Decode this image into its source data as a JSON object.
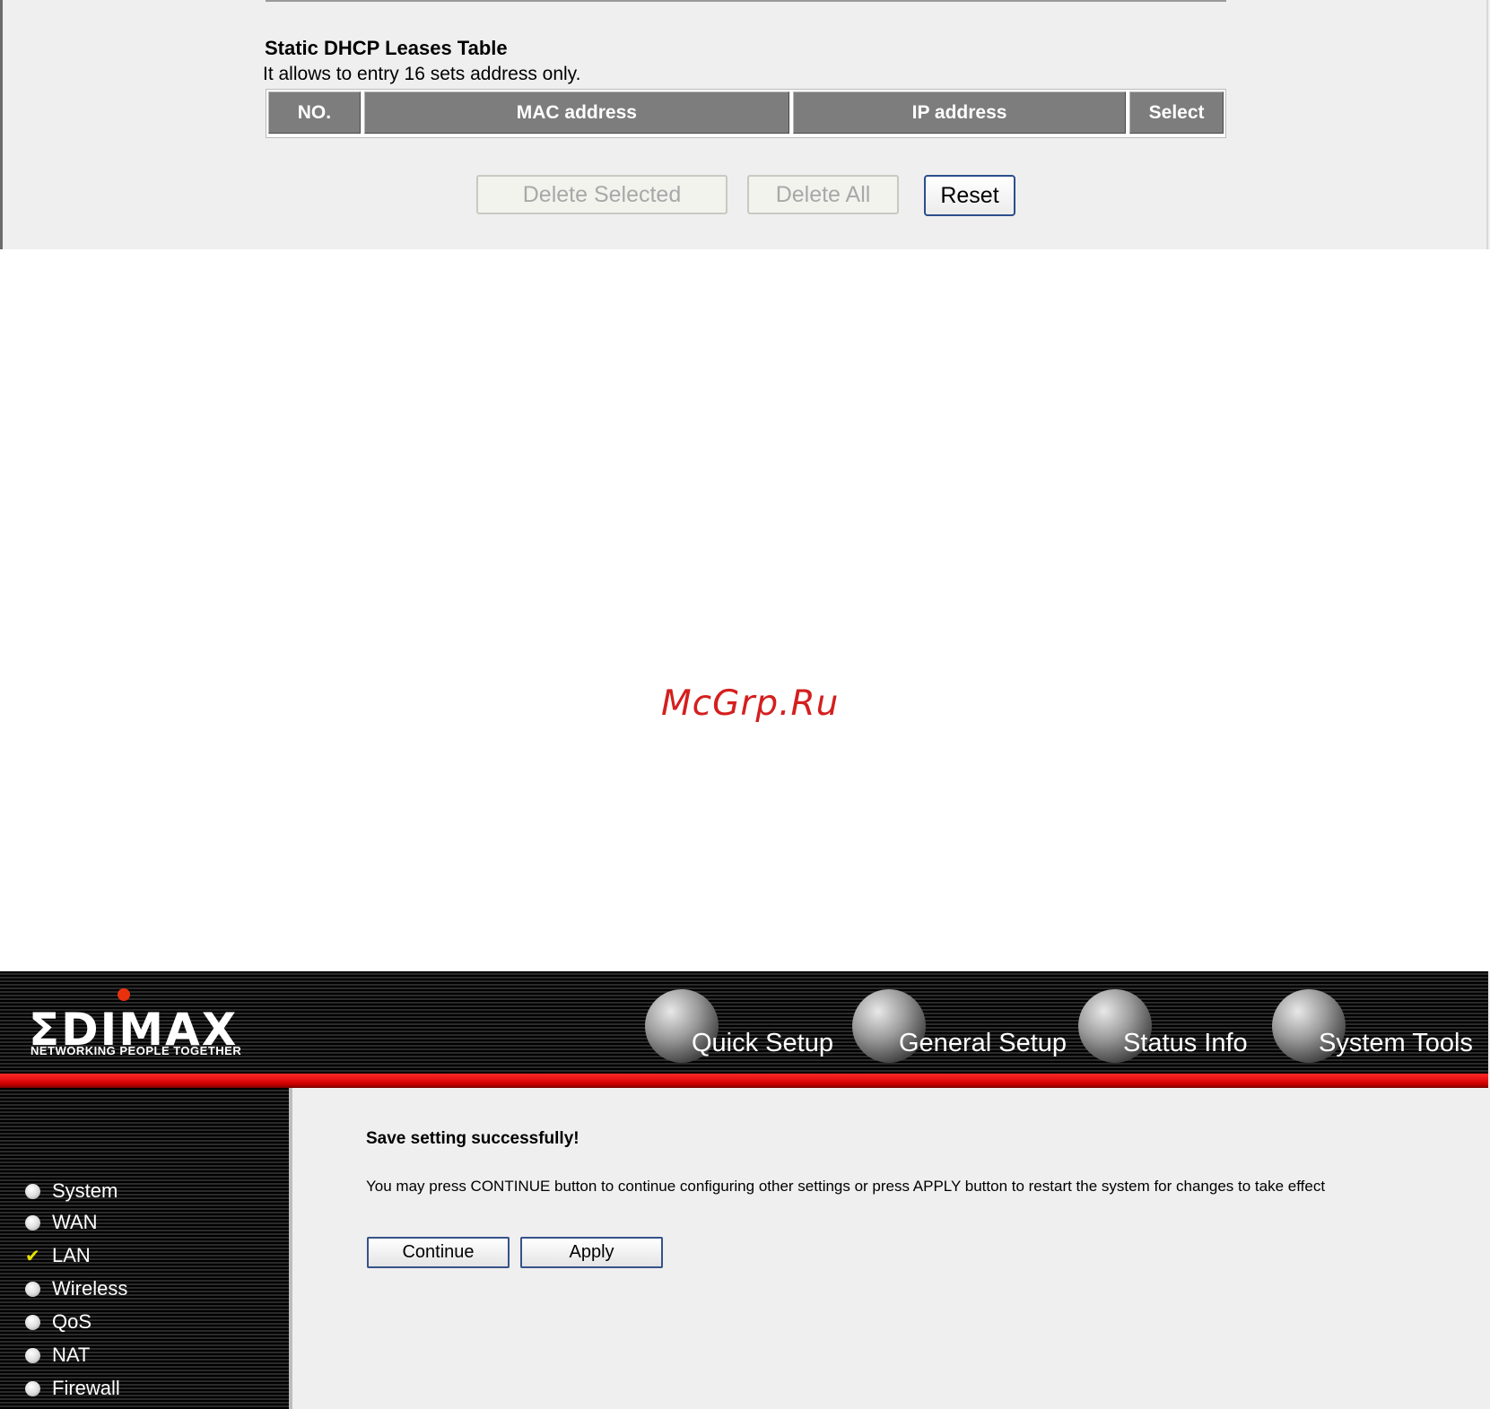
{
  "dhcp_table": {
    "title": "Static DHCP Leases Table",
    "subtitle": "It allows to entry 16 sets address only.",
    "columns": [
      "NO.",
      "MAC address",
      "IP address",
      "Select"
    ],
    "rows": []
  },
  "dhcp_buttons": {
    "delete_selected": "Delete Selected",
    "delete_all": "Delete All",
    "reset": "Reset"
  },
  "watermark": "McGrp.Ru",
  "router": {
    "logo": "ΣDIMAX",
    "tagline": "NETWORKING PEOPLE TOGETHER",
    "nav": [
      {
        "label": "Quick Setup",
        "icon": "quick-setup-globe-icon"
      },
      {
        "label": "General Setup",
        "icon": "general-setup-globe-icon"
      },
      {
        "label": "Status Info",
        "icon": "status-info-globe-icon"
      },
      {
        "label": "System Tools",
        "icon": "system-tools-globe-icon"
      }
    ],
    "sidebar": [
      {
        "label": "System",
        "icon": "radio-bullet-icon"
      },
      {
        "label": "WAN",
        "icon": "radio-bullet-icon"
      },
      {
        "label": "LAN",
        "icon": "checkmark-icon",
        "selected": true
      },
      {
        "label": "Wireless",
        "icon": "radio-bullet-icon"
      },
      {
        "label": "QoS",
        "icon": "radio-bullet-icon"
      },
      {
        "label": "NAT",
        "icon": "radio-bullet-icon"
      },
      {
        "label": "Firewall",
        "icon": "radio-bullet-icon"
      }
    ],
    "content": {
      "save_message": "Save setting successfully!",
      "info_message": "You may press CONTINUE button to continue configuring other settings or press APPLY button to restart the system for changes to take effect",
      "continue_label": "Continue",
      "apply_label": "Apply"
    }
  },
  "colors": {
    "panel_bg": "#efefef",
    "table_header_bg": "#7d7d7d",
    "brand_red": "#d10000",
    "watermark_red": "#d41f1f",
    "button_border": "#2b4e8c",
    "check_yellow": "#e9e200"
  }
}
